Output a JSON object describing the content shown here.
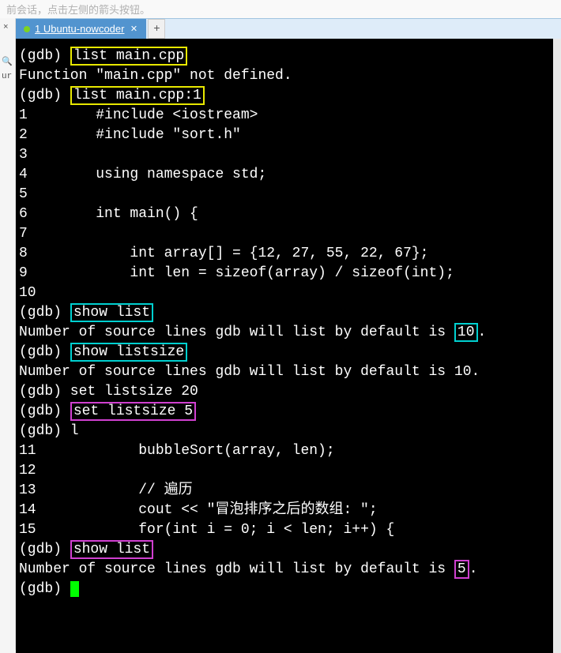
{
  "topHint": "前会话，点击左侧的箭头按钮。",
  "sidebar": {
    "close": "×",
    "iconA": "🔍",
    "iconB": "ur"
  },
  "tab": {
    "title": "1 Ubuntu-nowcoder",
    "close": "✕",
    "newTab": "+"
  },
  "lines": [
    {
      "segs": [
        {
          "t": "(gdb) "
        },
        {
          "t": "list main.cpp",
          "cls": "hl-yellow"
        }
      ]
    },
    {
      "segs": [
        {
          "t": "Function \"main.cpp\" not defined."
        }
      ]
    },
    {
      "segs": [
        {
          "t": "(gdb) "
        },
        {
          "t": "list main.cpp:1",
          "cls": "hl-yellow"
        }
      ]
    },
    {
      "segs": [
        {
          "t": "1        #include <iostream>"
        }
      ]
    },
    {
      "segs": [
        {
          "t": "2        #include \"sort.h\""
        }
      ]
    },
    {
      "segs": [
        {
          "t": "3"
        }
      ]
    },
    {
      "segs": [
        {
          "t": "4        using namespace std;"
        }
      ]
    },
    {
      "segs": [
        {
          "t": "5"
        }
      ]
    },
    {
      "segs": [
        {
          "t": "6        int main() {"
        }
      ]
    },
    {
      "segs": [
        {
          "t": "7"
        }
      ]
    },
    {
      "segs": [
        {
          "t": "8            int array[] = {12, 27, 55, 22, 67};"
        }
      ]
    },
    {
      "segs": [
        {
          "t": "9            int len = sizeof(array) / sizeof(int);"
        }
      ]
    },
    {
      "segs": [
        {
          "t": "10"
        }
      ]
    },
    {
      "segs": [
        {
          "t": "(gdb) "
        },
        {
          "t": "show list",
          "cls": "hl-cyan"
        }
      ]
    },
    {
      "segs": [
        {
          "t": "Number of source lines gdb will list by default is "
        },
        {
          "t": "10",
          "cls": "hl-cyan"
        },
        {
          "t": "."
        }
      ]
    },
    {
      "segs": [
        {
          "t": "(gdb) "
        },
        {
          "t": "show listsize",
          "cls": "hl-cyan"
        }
      ]
    },
    {
      "segs": [
        {
          "t": "Number of source lines gdb will list by default is 10."
        }
      ]
    },
    {
      "segs": [
        {
          "t": "(gdb) set listsize 20"
        }
      ]
    },
    {
      "segs": [
        {
          "t": "(gdb) "
        },
        {
          "t": "set listsize 5",
          "cls": "hl-magenta"
        }
      ]
    },
    {
      "segs": [
        {
          "t": "(gdb) l"
        }
      ]
    },
    {
      "segs": [
        {
          "t": "11            bubbleSort(array, len);"
        }
      ]
    },
    {
      "segs": [
        {
          "t": "12"
        }
      ]
    },
    {
      "segs": [
        {
          "t": "13            // 遍历"
        }
      ]
    },
    {
      "segs": [
        {
          "t": "14            cout << \"冒泡排序之后的数组: \";"
        }
      ]
    },
    {
      "segs": [
        {
          "t": "15            for(int i = 0; i < len; i++) {"
        }
      ]
    },
    {
      "segs": [
        {
          "t": "(gdb) "
        },
        {
          "t": "show list",
          "cls": "hl-magenta"
        }
      ]
    },
    {
      "segs": [
        {
          "t": "Number of source lines gdb will list by default is "
        },
        {
          "t": "5",
          "cls": "hl-magenta"
        },
        {
          "t": "."
        }
      ]
    },
    {
      "segs": [
        {
          "t": "(gdb) "
        },
        {
          "cursor": true
        }
      ]
    }
  ]
}
